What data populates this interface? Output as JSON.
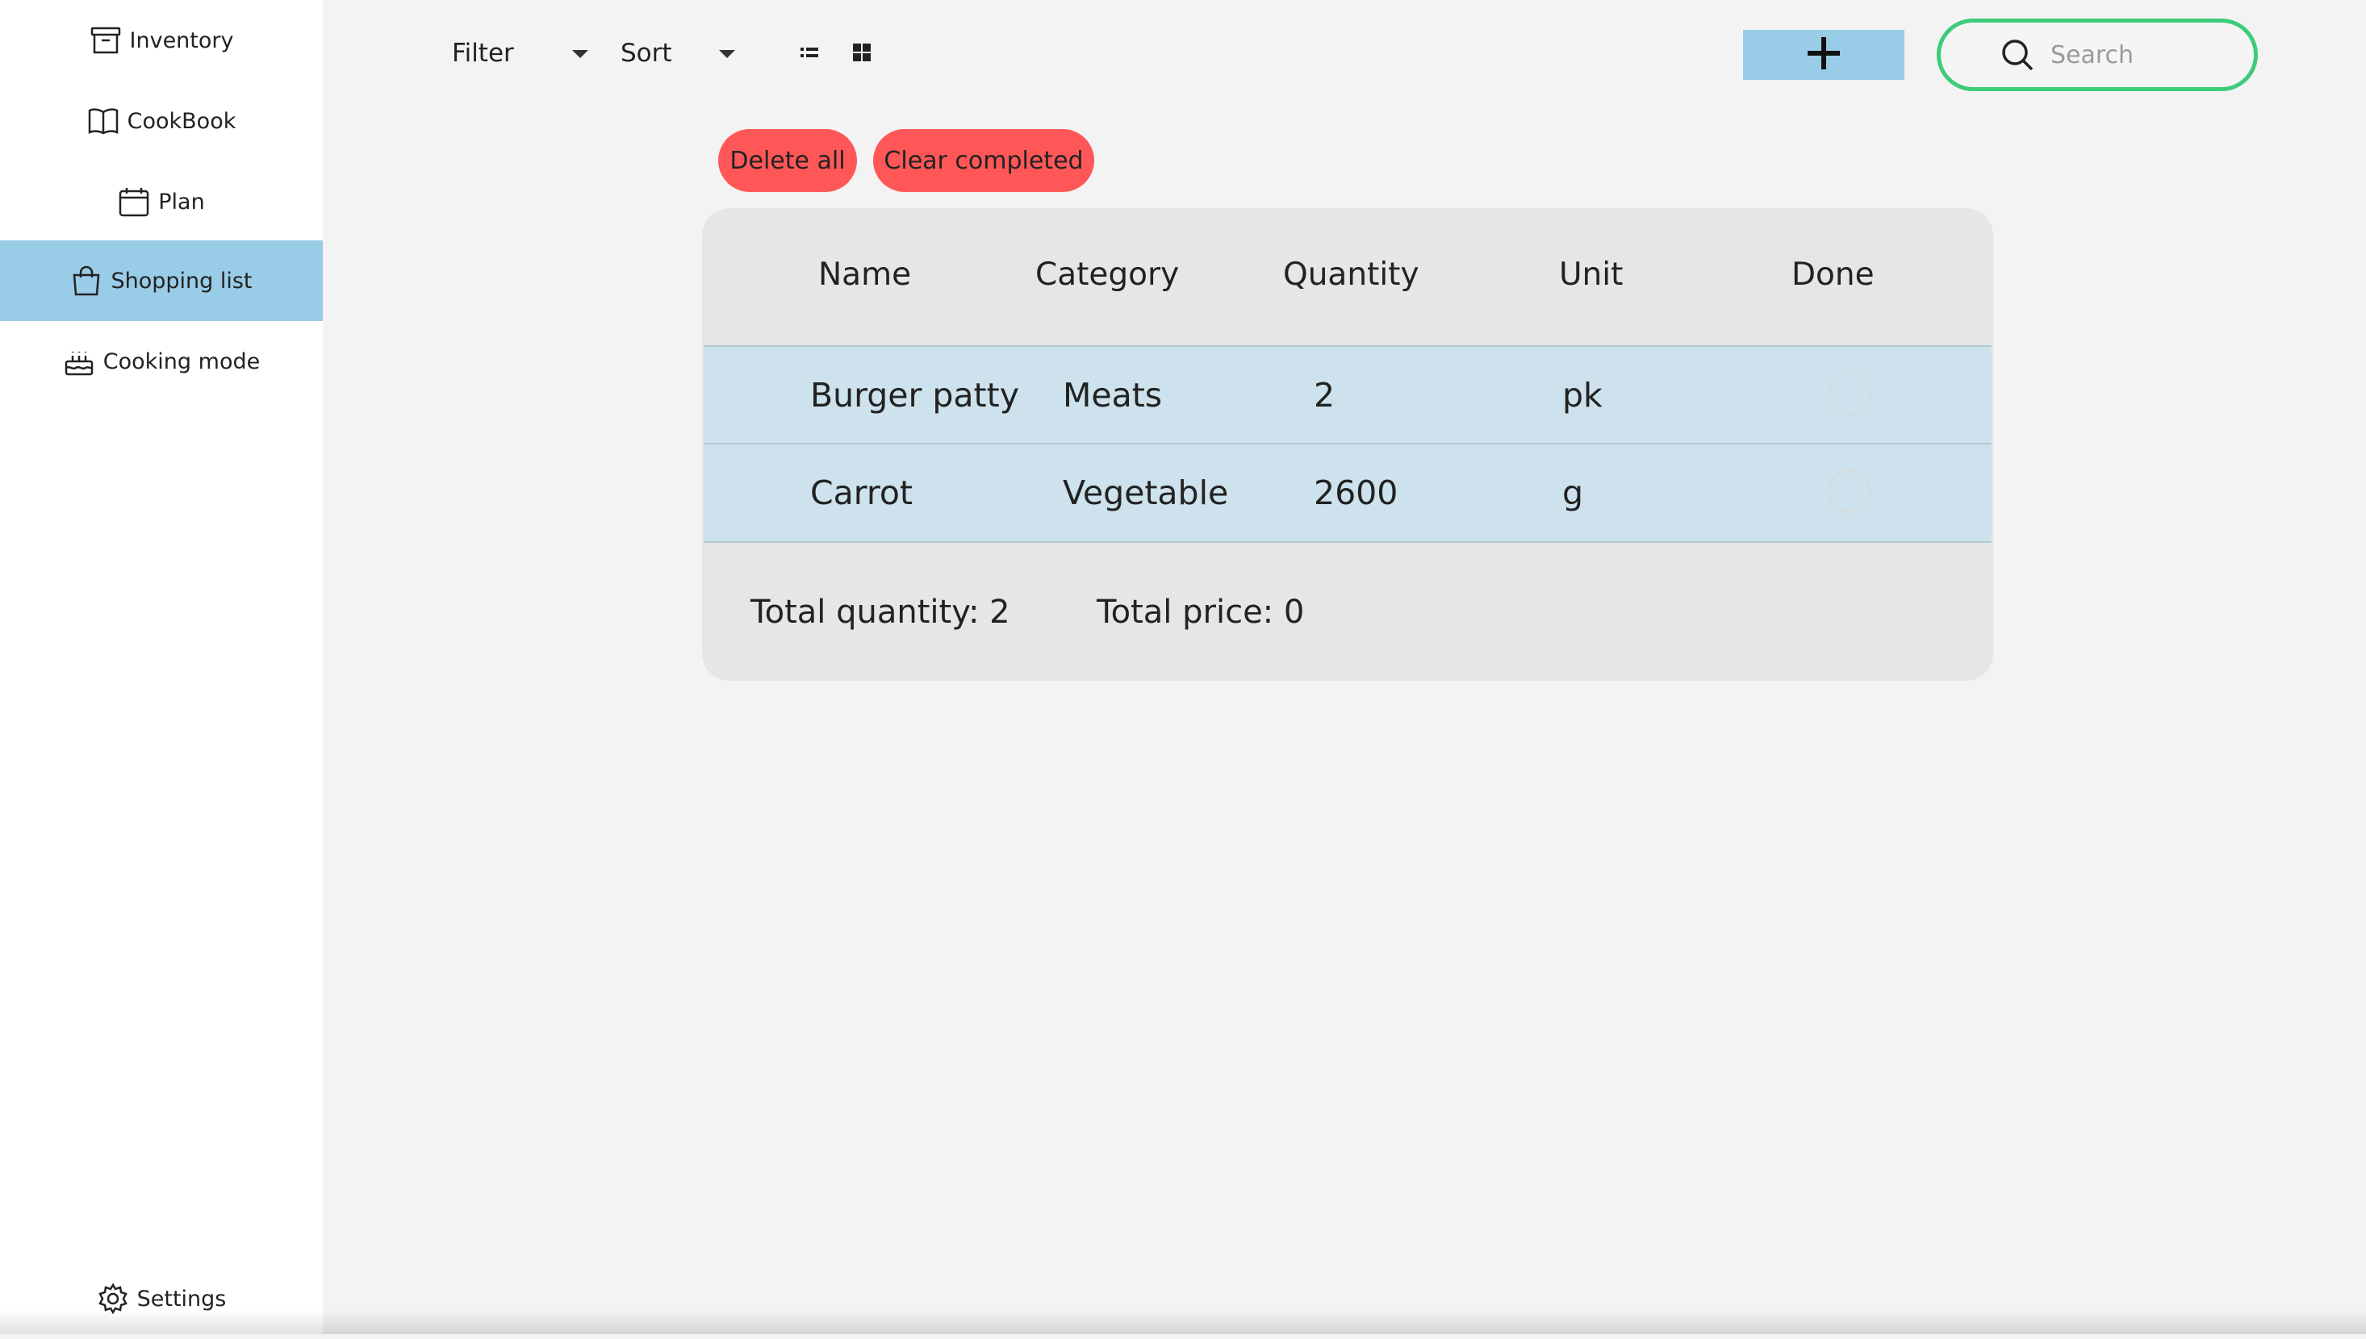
{
  "sidebar": {
    "items": [
      {
        "label": "Inventory",
        "icon": "archive-box-icon",
        "active": false
      },
      {
        "label": "CookBook",
        "icon": "open-book-icon",
        "active": false
      },
      {
        "label": "Plan",
        "icon": "calendar-icon",
        "active": false
      },
      {
        "label": "Shopping list",
        "icon": "shopping-bag-icon",
        "active": true
      },
      {
        "label": "Cooking mode",
        "icon": "cake-icon",
        "active": false
      }
    ],
    "settings_label": "Settings"
  },
  "toolbar": {
    "filter_label": "Filter",
    "sort_label": "Sort",
    "search_placeholder": "Search"
  },
  "actions": {
    "delete_all": "Delete all",
    "clear_completed": "Clear completed"
  },
  "table": {
    "columns": [
      "Name",
      "Category",
      "Quantity",
      "Unit",
      "Done"
    ],
    "rows": [
      {
        "name": "Burger patty",
        "category": "Meats",
        "quantity": "2",
        "unit": "pk",
        "done": false
      },
      {
        "name": "Carrot",
        "category": "Vegetable",
        "quantity": "2600",
        "unit": "g",
        "done": false
      }
    ],
    "total_quantity": "Total quantity: 2",
    "total_price": "Total price: 0"
  },
  "colors": {
    "active_nav": "#99cce6",
    "add_button": "#99cce6",
    "danger": "#ff5757",
    "search_border": "#3dcc7a",
    "row_bg": "#cde2ec"
  }
}
